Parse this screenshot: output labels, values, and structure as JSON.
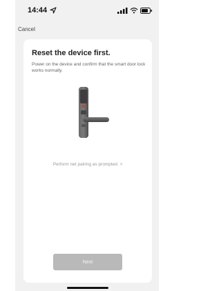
{
  "status_bar": {
    "time": "14:44",
    "icons": [
      "location-arrow-icon",
      "cellular-signal-icon",
      "wifi-icon",
      "battery-icon"
    ]
  },
  "nav": {
    "cancel_label": "Cancel"
  },
  "card": {
    "title": "Reset the device first.",
    "description": "Power on the device and confirm that the smart door lock works normally.",
    "illustration": "smart-door-lock-icon",
    "pairing_link": "Perform net pairing as prompted. >",
    "next_label": "Next"
  },
  "colors": {
    "background": "#f1f1f1",
    "card": "#ffffff",
    "button": "#b9b9b9",
    "lock_body": "#555555"
  }
}
